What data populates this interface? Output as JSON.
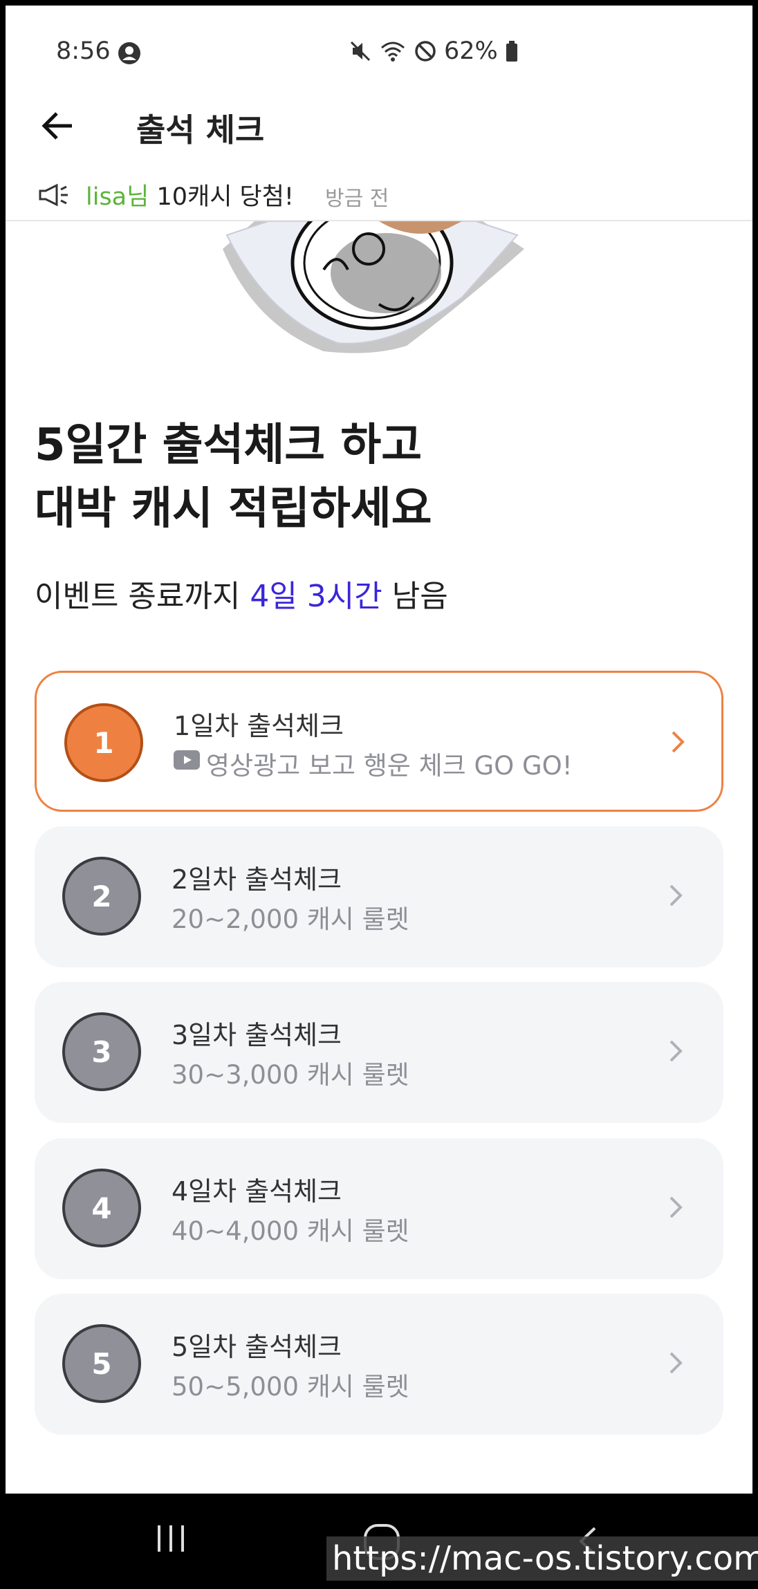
{
  "status_bar": {
    "time": "8:56",
    "battery": "62%"
  },
  "header": {
    "title": "출석 체크"
  },
  "ticker": {
    "user": "lisa님",
    "message": " 10캐시 당첨!",
    "time": "방금 전"
  },
  "headline": {
    "line1": "5일간 출석체크 하고",
    "line2": "대박 캐시 적립하세요"
  },
  "countdown": {
    "prefix": "이벤트 종료까지 ",
    "highlight": "4일 3시간",
    "suffix": " 남음"
  },
  "days": [
    {
      "number": "1",
      "title": "1일차 출석체크",
      "subtitle": "영상광고 보고 행운 체크 GO GO!"
    },
    {
      "number": "2",
      "title": "2일차 출석체크",
      "subtitle": "20~2,000 캐시 룰렛"
    },
    {
      "number": "3",
      "title": "3일차 출석체크",
      "subtitle": "30~3,000 캐시 룰렛"
    },
    {
      "number": "4",
      "title": "4일차 출석체크",
      "subtitle": "40~4,000 캐시 룰렛"
    },
    {
      "number": "5",
      "title": "5일차 출석체크",
      "subtitle": "50~5,000 캐시 룰렛"
    }
  ],
  "watermark": "https://mac-os.tistory.com",
  "colors": {
    "accent": "#ee8142",
    "highlight": "#3a26d9",
    "ticker_user": "#5ab53a"
  }
}
